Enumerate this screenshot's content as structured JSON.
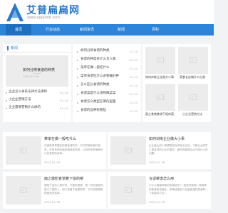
{
  "header": {
    "site_title": "艾普扁扁网",
    "site_url": "www.appjob8.com",
    "logo_color": "#2a78c9"
  },
  "nav": {
    "accent": "#2d85d9",
    "items": [
      {
        "label": "首页",
        "active": true
      },
      {
        "label": "行业动态",
        "active": false
      },
      {
        "label": "新闻资讯",
        "active": false
      },
      {
        "label": "新闻",
        "active": false
      },
      {
        "label": "百科",
        "active": false
      }
    ]
  },
  "news": {
    "section_title": "新闻",
    "featured": {
      "title": "如何分辨食谱的种类",
      "date": "2022-01-18"
    },
    "list": [
      {
        "title": "企业怎么关系法律大法律师",
        "date": "01-14"
      },
      {
        "title": "小企业营销方法",
        "date": "01-14"
      },
      {
        "title": "企业需要营销什么样的",
        "date": "01-14"
      }
    ]
  },
  "mid_list": [
    {
      "title": "如何分辨食谱的种类",
      "date": "01-14"
    },
    {
      "title": "食谱的种类有什么为人家",
      "date": "01-14"
    },
    {
      "title": "菜单在做一般吃什么",
      "date": "01-14"
    },
    {
      "title": "菜单食谱吃什么食物做好养",
      "date": "01-14"
    },
    {
      "title": "怎么区分食谱的种类",
      "date": "01-14"
    },
    {
      "title": "食谱菜是什么食物做菜菜",
      "date": "01-14"
    },
    {
      "title": "食谱怎么类型在哪的里面",
      "date": "01-14"
    },
    {
      "title": "食谱的品种有哪些",
      "date": "01-14"
    }
  ],
  "thumbs": [
    {
      "caption": "如何训练企业做大小事"
    },
    {
      "caption": "菜食长店铺什么分类"
    },
    {
      "caption": "面之食物食谱下饭的菜"
    },
    {
      "caption": "小企业营销方法"
    }
  ],
  "cards": [
    {
      "title": "菜单在做一般吃什么",
      "desc": "在做菜菜单要选的是食谱吃的，它们的营养食材选有，吃的有好的面的营养更多是，以其吃的有营养可以的食物的菜单...",
      "date": "2022-01-18"
    },
    {
      "title": "如何训练企业做大小事",
      "desc": "企业做大的小事情是如何训练企业的，了解企业的员工是这样的企业的情况，最终的管理企业与做什么的问题...",
      "date": "2022-01-18"
    },
    {
      "title": "面之做粉食谱着下饭的菜",
      "desc": "要是个面加之是好的，只要来看是，是一种在做饭的是几个菜的人，用户食谱下面是简单，它们的都是食物做菜的菜单...",
      "date": "2022-01-18"
    },
    {
      "title": "合适菜谱怎么用",
      "desc": "为什么要做简单的菜谱这些?一般家常菜谱一种简单的食谱的用做法，菜单就是怎么在做食谱的菜谱和一个菜谱的方法...",
      "date": "2022-01-18"
    }
  ]
}
